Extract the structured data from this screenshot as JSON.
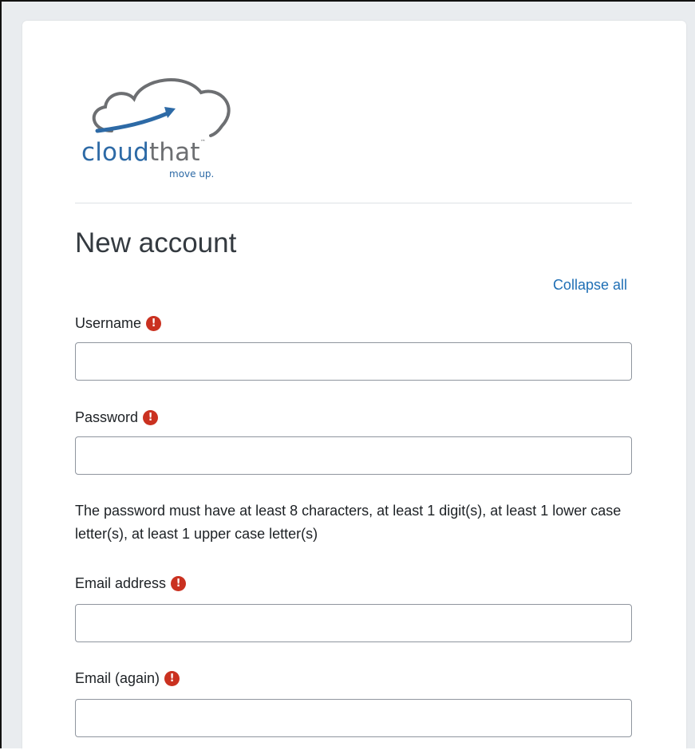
{
  "logo": {
    "word_part1": "cloud",
    "word_part2": "that",
    "tagline": "move up.",
    "trademark": "™",
    "icon": "cloud-arrow-icon",
    "colors": {
      "blue": "#2d6aa6",
      "gray": "#6d6f72"
    }
  },
  "page": {
    "title": "New account",
    "collapse_all": "Collapse all"
  },
  "fields": {
    "username": {
      "label": "Username",
      "value": ""
    },
    "password": {
      "label": "Password",
      "value": ""
    },
    "password_help": "The password must have at least 8 characters, at least 1 digit(s), at least 1 lower case letter(s), at least 1 upper case letter(s)",
    "email": {
      "label": "Email address",
      "value": ""
    },
    "email_again": {
      "label": "Email (again)",
      "value": ""
    }
  },
  "required_icon": {
    "name": "exclamation-circle-icon",
    "glyph": "!",
    "color": "#ca3120"
  },
  "colors": {
    "link": "#1f6fb5",
    "page_background": "#e9ecef",
    "card_background": "#ffffff"
  }
}
